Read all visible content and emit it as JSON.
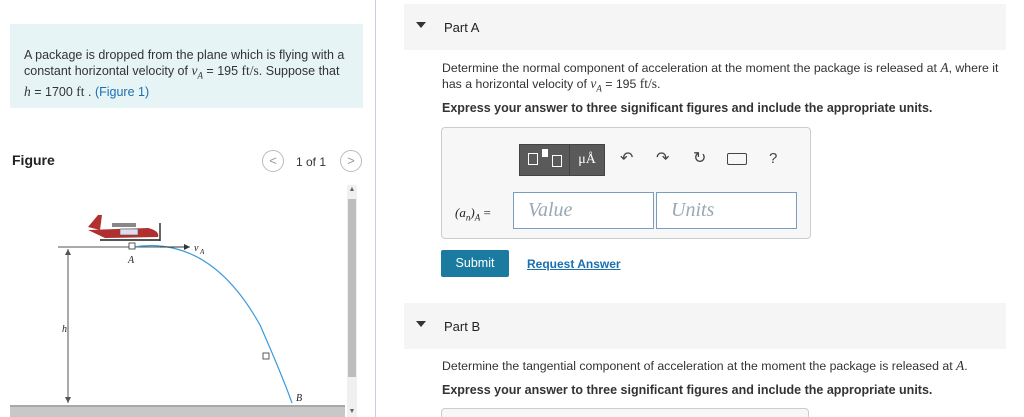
{
  "problem": {
    "text_1": "A package is dropped from the plane which is flying with a constant horizontal velocity of ",
    "v_symbol": "v",
    "v_sub": "A",
    "eq1": " = 195 ",
    "unit1": "ft/s",
    "text_2": ". Suppose that ",
    "h_symbol": "h",
    "eq2": " = 1700 ",
    "unit2": "ft",
    "text_3": " . ",
    "figure_link": "(Figure 1)"
  },
  "figure": {
    "title": "Figure",
    "pager": "1 of 1",
    "prev": "<",
    "next": ">",
    "labels": {
      "A": "A",
      "B": "B",
      "h": "h",
      "vA": "v",
      "vA_sub": "A"
    }
  },
  "part_a": {
    "title": "Part A",
    "question_1": "Determine the normal component of acceleration at the moment the package is released at ",
    "point": "A",
    "question_2": ", where it has a horizontal velocity of ",
    "v_symbol": "v",
    "v_sub": "A",
    "eq": " = 195 ",
    "unit": "ft/s",
    "question_end": ".",
    "instructions": "Express your answer to three significant figures and include the appropriate units.",
    "toolbar": {
      "units_label": "μÅ",
      "undo": "↶",
      "redo": "↷",
      "reset": "↻",
      "help": "?"
    },
    "answer_label": "(a",
    "answer_label_sub": "n",
    "answer_label_end": ")",
    "answer_label_sub2": "A",
    "answer_label_eq": " =",
    "value_placeholder": "Value",
    "units_placeholder": "Units",
    "submit": "Submit",
    "request": "Request Answer"
  },
  "part_b": {
    "title": "Part B",
    "question_1": "Determine the tangential component of acceleration at the moment the package is released at ",
    "point": "A",
    "question_end": ".",
    "instructions": "Express your answer to three significant figures and include the appropriate units."
  },
  "colors": {
    "problem_bg": "#e6f4f6",
    "link": "#1a6faf",
    "submit_bg": "#1a7aa0",
    "trajectory": "#3a9ad9"
  }
}
